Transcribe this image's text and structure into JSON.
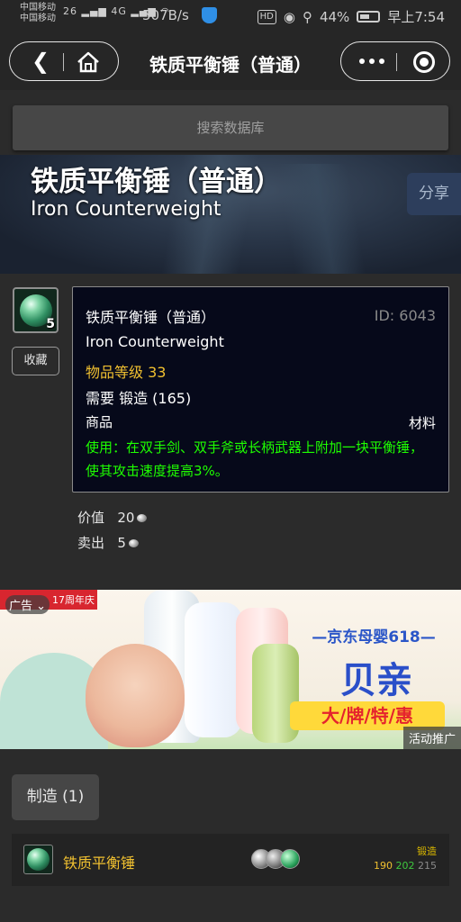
{
  "status_bar": {
    "carrier1": "中国移动",
    "carrier2": "中国移动",
    "signal1": "26",
    "signal2": "4G",
    "speed": "507B/s",
    "hd": "HD",
    "battery": "44%",
    "time": "早上7:54"
  },
  "nav": {
    "title": "铁质平衡锤（普通）"
  },
  "search": {
    "placeholder": "搜索数据库"
  },
  "hero": {
    "title_cn": "铁质平衡锤（普通）",
    "title_en": "Iron Counterweight",
    "share_label": "分享"
  },
  "item": {
    "stack_count": "5",
    "favorite_label": "收藏",
    "name_cn": "铁质平衡锤（普通）",
    "id_text": "ID: 6043",
    "name_en": "Iron Counterweight",
    "item_level": "物品等级 33",
    "requirement": "需要 锻造 (165)",
    "category_left": "商品",
    "category_right": "材料",
    "use_text": "使用：在双手剑、双手斧或长柄武器上附加一块平衡锤，使其攻击速度提高3%。",
    "value_label": "价值",
    "value_amount": "20",
    "sell_label": "卖出",
    "sell_amount": "5"
  },
  "ad": {
    "ad_tag": "广告",
    "anniversary": "17周年庆",
    "jd_title": "—京东母婴618—",
    "brand": "贝亲",
    "slogan": "大/牌/特/惠",
    "promo_label": "活动推广"
  },
  "crafting": {
    "tab_label": "制造 (1)",
    "recipe_name": "铁质平衡锤",
    "skill_name": "锻造",
    "skill_levels": [
      "190",
      "202",
      "215"
    ]
  },
  "colors": {
    "quality_yellow": "#f0c030",
    "use_green": "#1eff00",
    "tooltip_bg": "#06091a"
  }
}
